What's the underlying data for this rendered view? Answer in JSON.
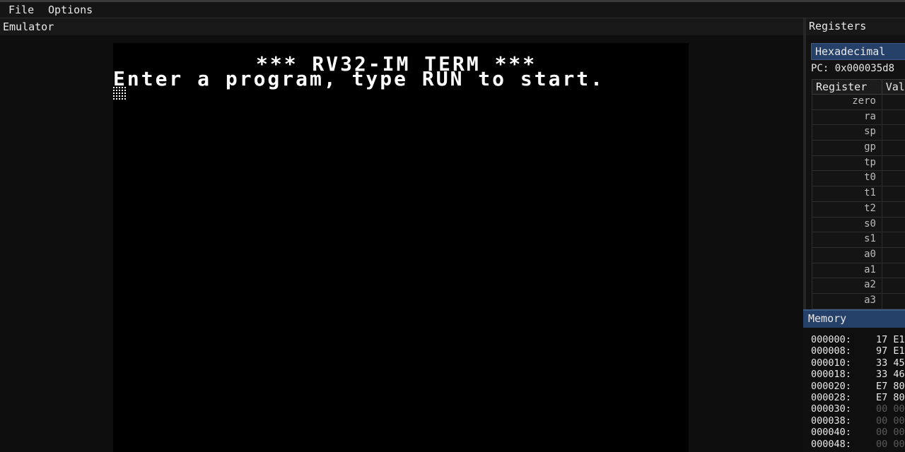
{
  "menu": {
    "file": "File",
    "options": "Options"
  },
  "emulator": {
    "title": "Emulator",
    "terminal_lines": [
      "*** RV32-IM TERM ***",
      "Enter a program, type RUN to start."
    ]
  },
  "registers": {
    "title": "Registers",
    "tab": "Hexadecimal",
    "pc": "PC: 0x000035d8",
    "columns": [
      "Register",
      "Val"
    ],
    "rows": [
      "zero",
      "ra",
      "sp",
      "gp",
      "tp",
      "t0",
      "t1",
      "t2",
      "s0",
      "s1",
      "a0",
      "a1",
      "a2",
      "a3"
    ]
  },
  "memory": {
    "title": "Memory",
    "rows": [
      {
        "addr": "000000:",
        "bytes": "17 E1"
      },
      {
        "addr": "000008:",
        "bytes": "97 E1"
      },
      {
        "addr": "000010:",
        "bytes": "33 45"
      },
      {
        "addr": "000018:",
        "bytes": "33 46"
      },
      {
        "addr": "000020:",
        "bytes": "E7 80"
      },
      {
        "addr": "000028:",
        "bytes": "E7 80"
      },
      {
        "addr": "000030:",
        "bytes": "00 00"
      },
      {
        "addr": "000038:",
        "bytes": "00 00"
      },
      {
        "addr": "000040:",
        "bytes": "00 00"
      },
      {
        "addr": "000048:",
        "bytes": "00 00"
      }
    ]
  }
}
